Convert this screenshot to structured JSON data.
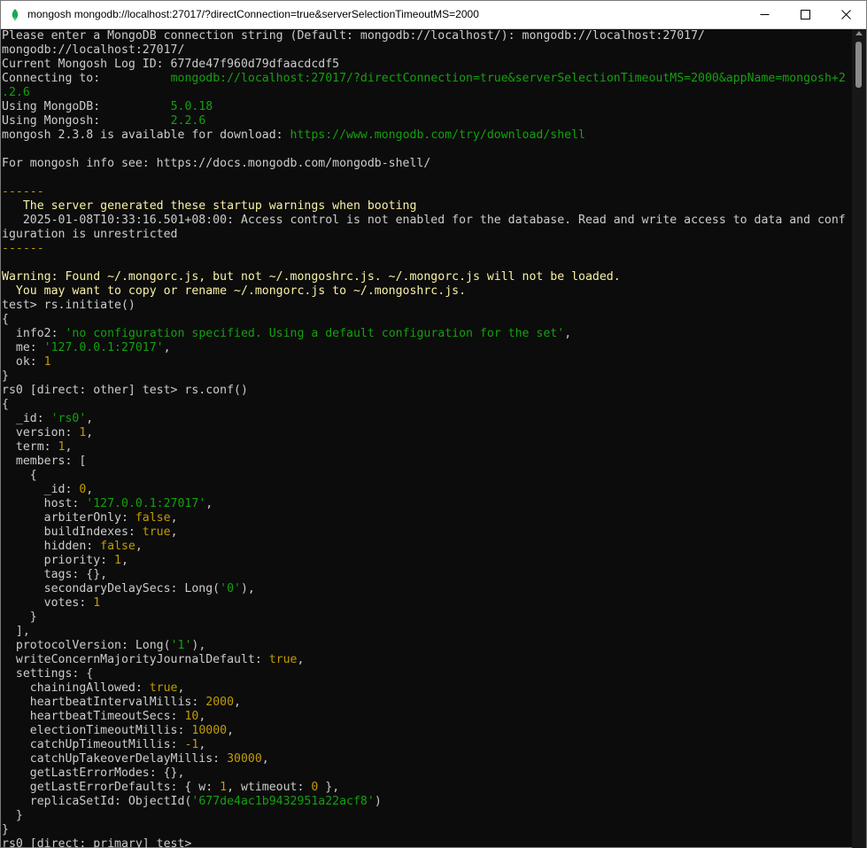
{
  "window": {
    "title": "mongosh mongodb://localhost:27017/?directConnection=true&serverSelectionTimeoutMS=2000"
  },
  "lines": [
    [
      {
        "t": "Please enter a MongoDB connection string (Default: mongodb://localhost/): mongodb://localhost:27017/",
        "c": "w"
      }
    ],
    [
      {
        "t": "mongodb://localhost:27017/",
        "c": "w"
      }
    ],
    [
      {
        "t": "Current Mongosh Log ID: 677de47f960d79dfaacdcdf5",
        "c": "w"
      }
    ],
    [
      {
        "t": "Connecting to:          ",
        "c": "w"
      },
      {
        "t": "mongodb://localhost:27017/?directConnection=true&serverSelectionTimeoutMS=2000&appName=mongosh+2",
        "c": "g"
      }
    ],
    [
      {
        "t": ".2.6",
        "c": "g"
      }
    ],
    [
      {
        "t": "Using MongoDB:          ",
        "c": "w"
      },
      {
        "t": "5.0.18",
        "c": "g"
      }
    ],
    [
      {
        "t": "Using Mongosh:          ",
        "c": "w"
      },
      {
        "t": "2.2.6",
        "c": "g"
      }
    ],
    [
      {
        "t": "mongosh 2.3.8 is available for download: ",
        "c": "w"
      },
      {
        "t": "https://www.mongodb.com/try/download/shell",
        "c": "g"
      }
    ],
    [
      {
        "t": "",
        "c": "w"
      }
    ],
    [
      {
        "t": "For mongosh info see: https://docs.mongodb.com/mongodb-shell/",
        "c": "w"
      }
    ],
    [
      {
        "t": "",
        "c": "w"
      }
    ],
    [
      {
        "t": "------",
        "c": "y"
      }
    ],
    [
      {
        "t": "   The server generated these startup warnings when booting",
        "c": "wy"
      }
    ],
    [
      {
        "t": "   2025-01-08T10:33:16.501+08:00: Access control is not enabled for the database. Read and write access to data and conf",
        "c": "w"
      }
    ],
    [
      {
        "t": "iguration is unrestricted",
        "c": "w"
      }
    ],
    [
      {
        "t": "------",
        "c": "y"
      }
    ],
    [
      {
        "t": "",
        "c": "w"
      }
    ],
    [
      {
        "t": "Warning: Found ~/.mongorc.js, but not ~/.mongoshrc.js. ~/.mongorc.js will not be loaded.",
        "c": "wy"
      }
    ],
    [
      {
        "t": "  You may want to copy or rename ~/.mongorc.js to ~/.mongoshrc.js.",
        "c": "wy"
      }
    ],
    [
      {
        "t": "test> rs.initiate()",
        "c": "w"
      }
    ],
    [
      {
        "t": "{",
        "c": "w"
      }
    ],
    [
      {
        "t": "  info2: ",
        "c": "w"
      },
      {
        "t": "'no configuration specified. Using a default configuration for the set'",
        "c": "g"
      },
      {
        "t": ",",
        "c": "w"
      }
    ],
    [
      {
        "t": "  me: ",
        "c": "w"
      },
      {
        "t": "'127.0.0.1:27017'",
        "c": "g"
      },
      {
        "t": ",",
        "c": "w"
      }
    ],
    [
      {
        "t": "  ok: ",
        "c": "w"
      },
      {
        "t": "1",
        "c": "y"
      }
    ],
    [
      {
        "t": "}",
        "c": "w"
      }
    ],
    [
      {
        "t": "rs0 [direct: other] test> rs.conf()",
        "c": "w"
      }
    ],
    [
      {
        "t": "{",
        "c": "w"
      }
    ],
    [
      {
        "t": "  _id: ",
        "c": "w"
      },
      {
        "t": "'rs0'",
        "c": "g"
      },
      {
        "t": ",",
        "c": "w"
      }
    ],
    [
      {
        "t": "  version: ",
        "c": "w"
      },
      {
        "t": "1",
        "c": "y"
      },
      {
        "t": ",",
        "c": "w"
      }
    ],
    [
      {
        "t": "  term: ",
        "c": "w"
      },
      {
        "t": "1",
        "c": "y"
      },
      {
        "t": ",",
        "c": "w"
      }
    ],
    [
      {
        "t": "  members: [",
        "c": "w"
      }
    ],
    [
      {
        "t": "    {",
        "c": "w"
      }
    ],
    [
      {
        "t": "      _id: ",
        "c": "w"
      },
      {
        "t": "0",
        "c": "y"
      },
      {
        "t": ",",
        "c": "w"
      }
    ],
    [
      {
        "t": "      host: ",
        "c": "w"
      },
      {
        "t": "'127.0.0.1:27017'",
        "c": "g"
      },
      {
        "t": ",",
        "c": "w"
      }
    ],
    [
      {
        "t": "      arbiterOnly: ",
        "c": "w"
      },
      {
        "t": "false",
        "c": "y"
      },
      {
        "t": ",",
        "c": "w"
      }
    ],
    [
      {
        "t": "      buildIndexes: ",
        "c": "w"
      },
      {
        "t": "true",
        "c": "y"
      },
      {
        "t": ",",
        "c": "w"
      }
    ],
    [
      {
        "t": "      hidden: ",
        "c": "w"
      },
      {
        "t": "false",
        "c": "y"
      },
      {
        "t": ",",
        "c": "w"
      }
    ],
    [
      {
        "t": "      priority: ",
        "c": "w"
      },
      {
        "t": "1",
        "c": "y"
      },
      {
        "t": ",",
        "c": "w"
      }
    ],
    [
      {
        "t": "      tags: {},",
        "c": "w"
      }
    ],
    [
      {
        "t": "      secondaryDelaySecs: Long(",
        "c": "w"
      },
      {
        "t": "'0'",
        "c": "g"
      },
      {
        "t": "),",
        "c": "w"
      }
    ],
    [
      {
        "t": "      votes: ",
        "c": "w"
      },
      {
        "t": "1",
        "c": "y"
      }
    ],
    [
      {
        "t": "    }",
        "c": "w"
      }
    ],
    [
      {
        "t": "  ],",
        "c": "w"
      }
    ],
    [
      {
        "t": "  protocolVersion: Long(",
        "c": "w"
      },
      {
        "t": "'1'",
        "c": "g"
      },
      {
        "t": "),",
        "c": "w"
      }
    ],
    [
      {
        "t": "  writeConcernMajorityJournalDefault: ",
        "c": "w"
      },
      {
        "t": "true",
        "c": "y"
      },
      {
        "t": ",",
        "c": "w"
      }
    ],
    [
      {
        "t": "  settings: {",
        "c": "w"
      }
    ],
    [
      {
        "t": "    chainingAllowed: ",
        "c": "w"
      },
      {
        "t": "true",
        "c": "y"
      },
      {
        "t": ",",
        "c": "w"
      }
    ],
    [
      {
        "t": "    heartbeatIntervalMillis: ",
        "c": "w"
      },
      {
        "t": "2000",
        "c": "y"
      },
      {
        "t": ",",
        "c": "w"
      }
    ],
    [
      {
        "t": "    heartbeatTimeoutSecs: ",
        "c": "w"
      },
      {
        "t": "10",
        "c": "y"
      },
      {
        "t": ",",
        "c": "w"
      }
    ],
    [
      {
        "t": "    electionTimeoutMillis: ",
        "c": "w"
      },
      {
        "t": "10000",
        "c": "y"
      },
      {
        "t": ",",
        "c": "w"
      }
    ],
    [
      {
        "t": "    catchUpTimeoutMillis: ",
        "c": "w"
      },
      {
        "t": "-1",
        "c": "y"
      },
      {
        "t": ",",
        "c": "w"
      }
    ],
    [
      {
        "t": "    catchUpTakeoverDelayMillis: ",
        "c": "w"
      },
      {
        "t": "30000",
        "c": "y"
      },
      {
        "t": ",",
        "c": "w"
      }
    ],
    [
      {
        "t": "    getLastErrorModes: {},",
        "c": "w"
      }
    ],
    [
      {
        "t": "    getLastErrorDefaults: { w: ",
        "c": "w"
      },
      {
        "t": "1",
        "c": "y"
      },
      {
        "t": ", wtimeout: ",
        "c": "w"
      },
      {
        "t": "0",
        "c": "y"
      },
      {
        "t": " },",
        "c": "w"
      }
    ],
    [
      {
        "t": "    replicaSetId: ObjectId(",
        "c": "w"
      },
      {
        "t": "'677de4ac1b9432951a22acf8'",
        "c": "g"
      },
      {
        "t": ")",
        "c": "w"
      }
    ],
    [
      {
        "t": "  }",
        "c": "w"
      }
    ],
    [
      {
        "t": "}",
        "c": "w"
      }
    ],
    [
      {
        "t": "rs0 [direct: primary] test>",
        "c": "w"
      }
    ]
  ]
}
